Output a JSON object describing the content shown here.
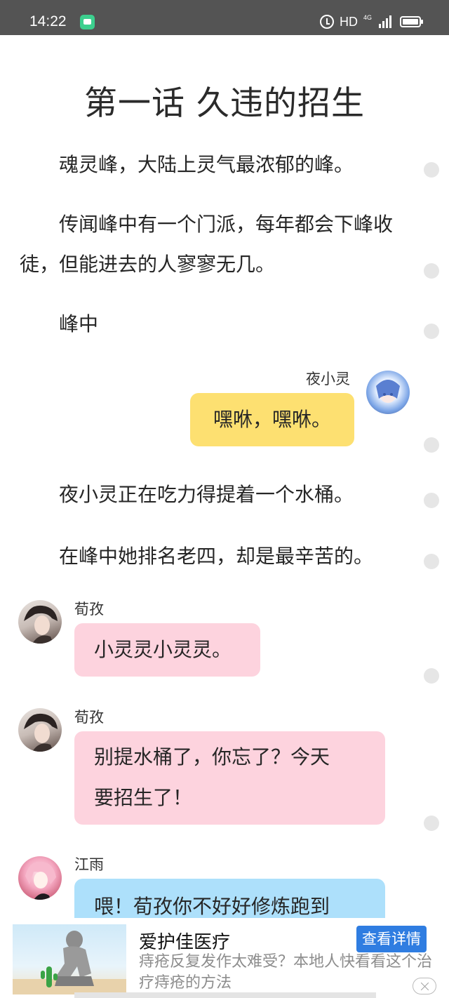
{
  "status_bar": {
    "time": "14:22",
    "hd": "HD",
    "network": "4G",
    "icons": [
      "chat-notification-icon",
      "alarm-icon",
      "signal-icon",
      "battery-icon"
    ]
  },
  "chapter": {
    "title": "第一话  久违的招生"
  },
  "paragraphs": [
    "魂灵峰，大陆上灵气最浓郁的峰。",
    "传闻峰中有一个门派，每年都会下峰收徒，但能进去的人寥寥无几。",
    "峰中",
    "夜小灵正在吃力得提着一个水桶。",
    "在峰中她排名老四，却是最辛苦的。"
  ],
  "dialogs": [
    {
      "speaker": "夜小灵",
      "text": "嘿咻，嘿咻。",
      "color": "#fde071"
    },
    {
      "speaker": "荀孜",
      "text": "小灵灵小灵灵。",
      "color": "#fdd3de"
    },
    {
      "speaker": "荀孜",
      "lines": [
        "别提水桶了，你忘了？今天",
        "要招生了！"
      ],
      "color": "#fdd3de"
    },
    {
      "speaker": "江雨",
      "text": "喂！荀孜你不好好修炼跑到",
      "color": "#ade0fb"
    }
  ],
  "ad": {
    "title": "爱护佳医疗",
    "button": "查看详情",
    "description": "痔疮反复发作太难受？本地人快看看这个治疗痔疮的方法"
  },
  "colors": {
    "status_bar": "#545454",
    "ad_button": "#2f7de1"
  }
}
